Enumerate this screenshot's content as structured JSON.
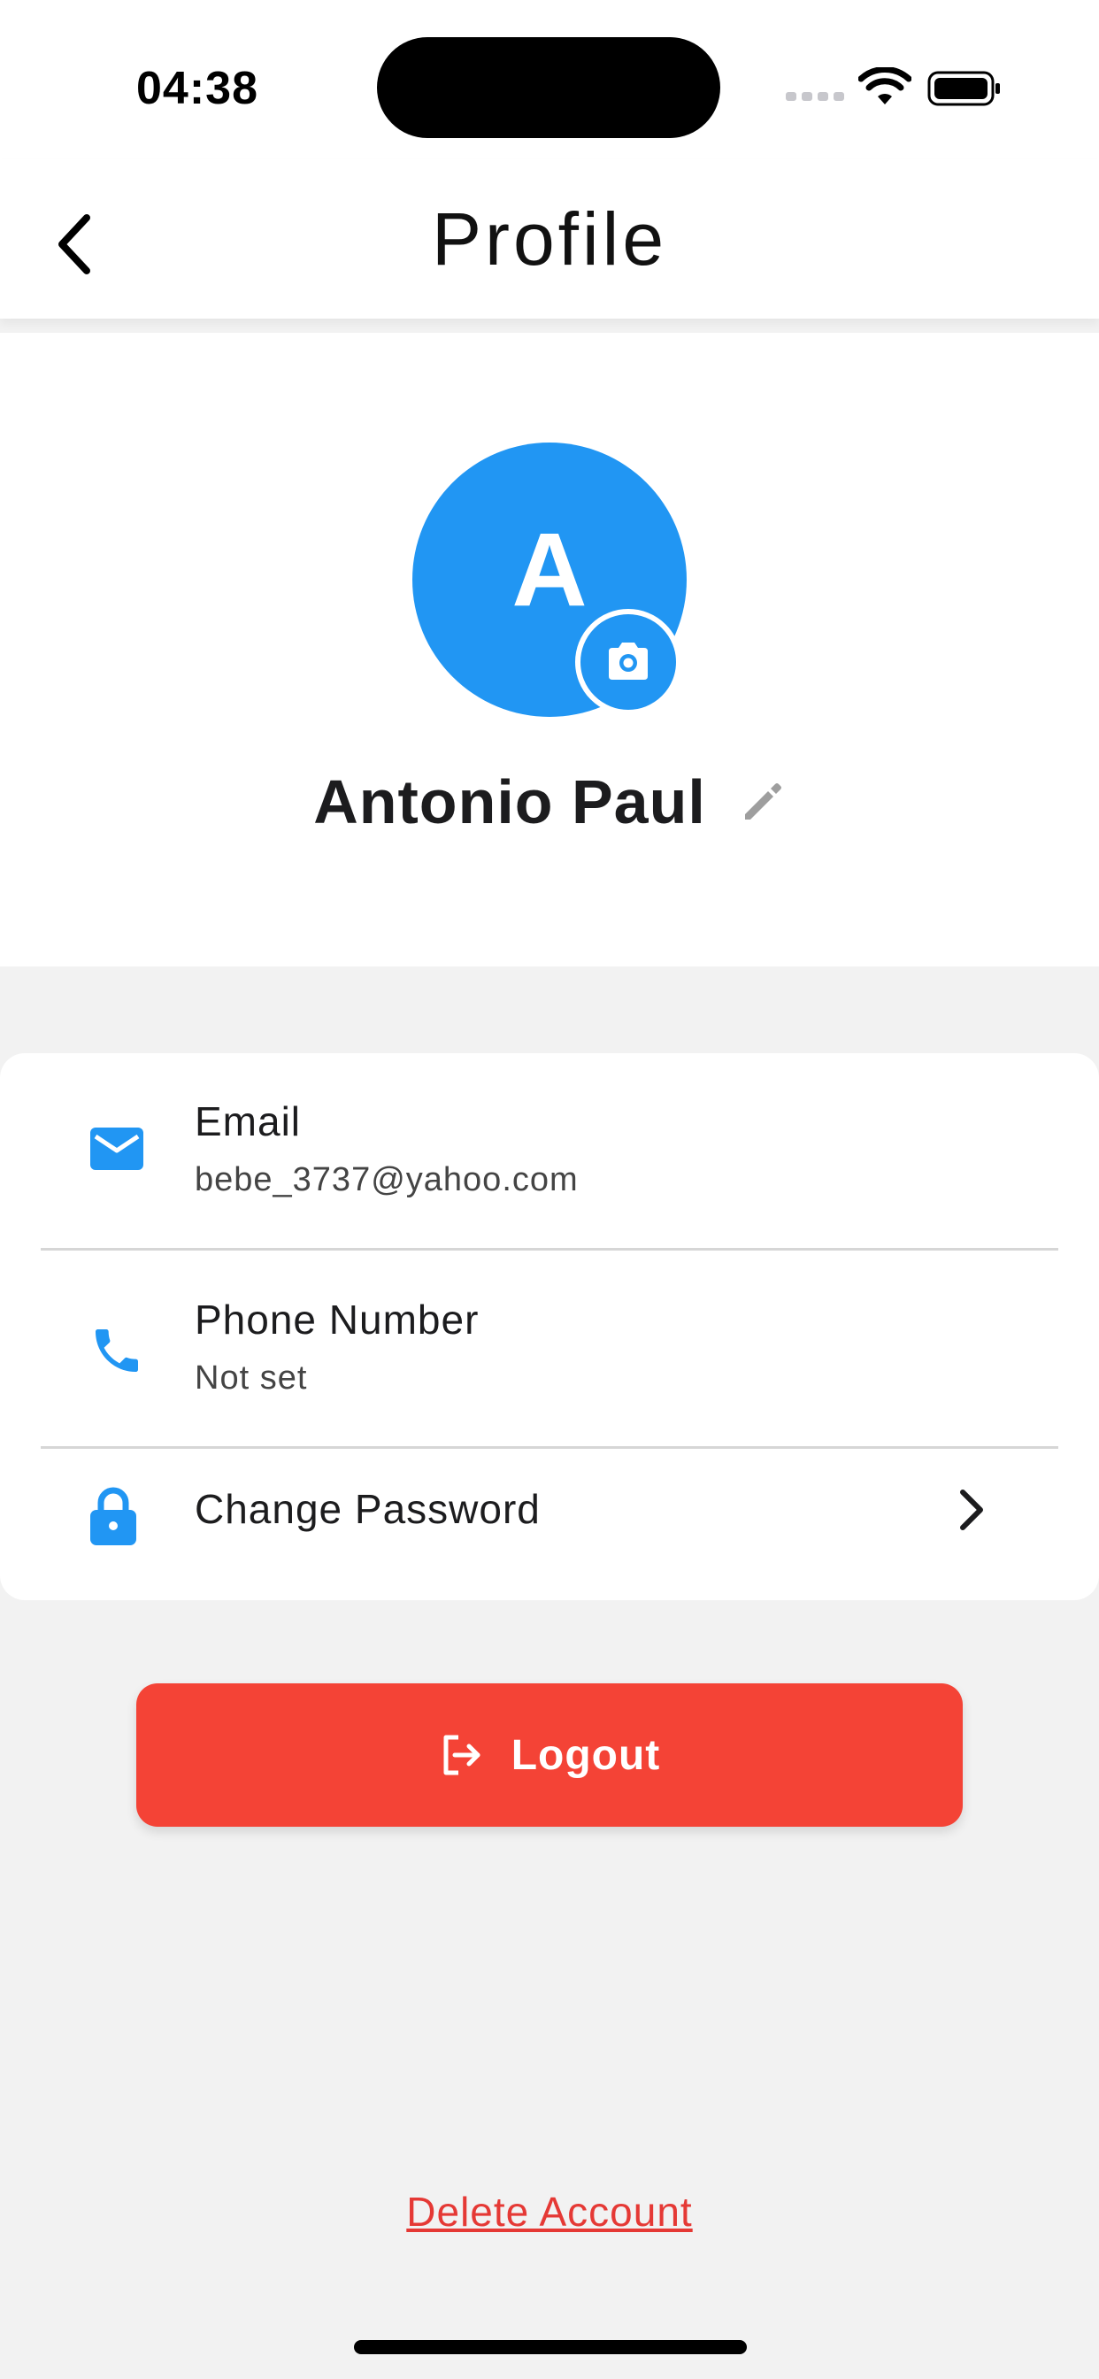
{
  "status_bar": {
    "time": "04:38",
    "icons": [
      "signal-icon",
      "wifi-icon",
      "battery-icon"
    ]
  },
  "nav": {
    "title": "Profile",
    "back_icon": "chevron-left-icon"
  },
  "profile": {
    "initial": "A",
    "name": "Antonio Paul",
    "avatar_color": "#2196f3",
    "camera_icon": "camera-icon",
    "edit_icon": "pencil-icon"
  },
  "info_rows": [
    {
      "icon": "email-icon",
      "label": "Email",
      "value": "bebe_3737@yahoo.com"
    },
    {
      "icon": "phone-icon",
      "label": "Phone Number",
      "value": "Not set"
    },
    {
      "icon": "lock-icon",
      "label": "Change Password",
      "trailing_icon": "chevron-right-icon"
    }
  ],
  "actions": {
    "logout_label": "Logout",
    "logout_icon": "logout-icon",
    "logout_color": "#f44336",
    "delete_account_label": "Delete Account",
    "delete_color": "#e53935"
  },
  "accent_color": "#2196f3"
}
